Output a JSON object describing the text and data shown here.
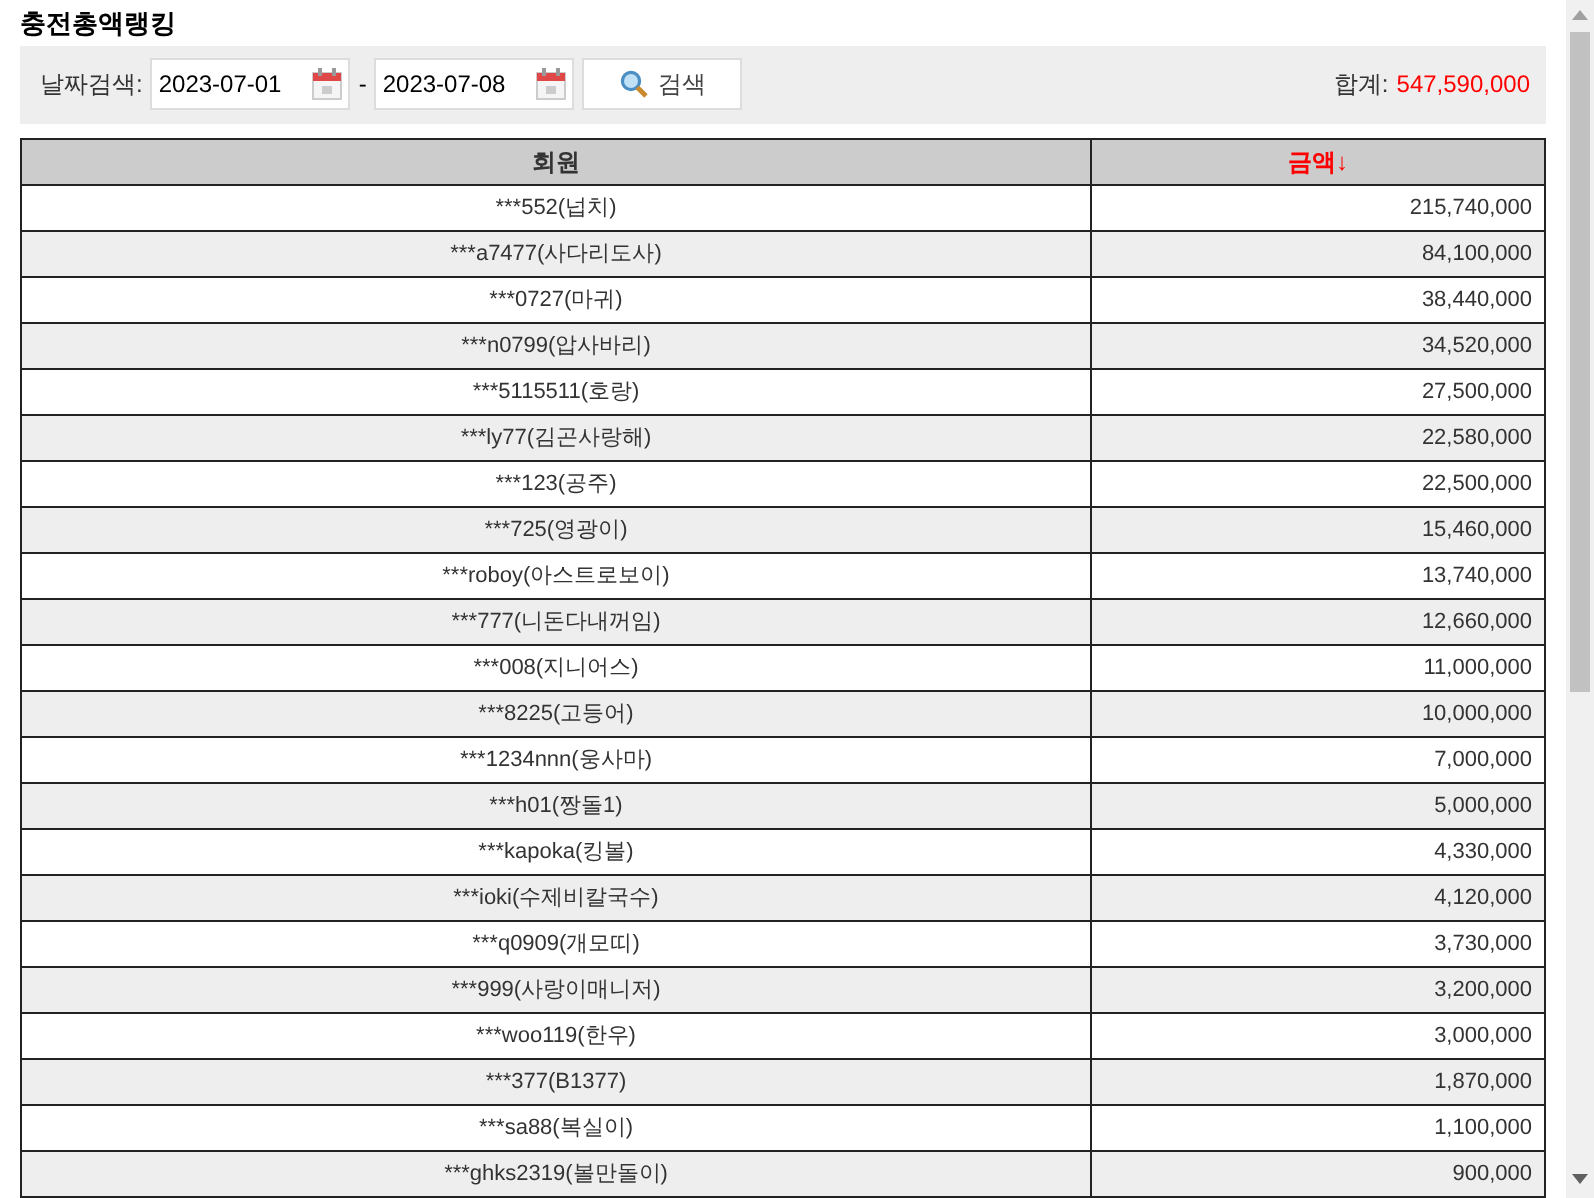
{
  "page_title": "충전총액랭킹",
  "search": {
    "label": "날짜검색:",
    "date_from": "2023-07-01",
    "separator": "-",
    "date_to": "2023-07-08",
    "button": "검색"
  },
  "total": {
    "label": "합계:",
    "value": "547,590,000"
  },
  "table": {
    "columns": [
      {
        "label": "회원",
        "sorted": false
      },
      {
        "label": "금액↓",
        "sorted": true
      }
    ],
    "rows": [
      {
        "member": "***552(넙치)",
        "amount": "215,740,000"
      },
      {
        "member": "***a7477(사다리도사)",
        "amount": "84,100,000"
      },
      {
        "member": "***0727(마귀)",
        "amount": "38,440,000"
      },
      {
        "member": "***n0799(압사바리)",
        "amount": "34,520,000"
      },
      {
        "member": "***5115511(호랑)",
        "amount": "27,500,000"
      },
      {
        "member": "***ly77(김곤사랑해)",
        "amount": "22,580,000"
      },
      {
        "member": "***123(공주)",
        "amount": "22,500,000"
      },
      {
        "member": "***725(영광이)",
        "amount": "15,460,000"
      },
      {
        "member": "***roboy(아스트로보이)",
        "amount": "13,740,000"
      },
      {
        "member": "***777(니돈다내꺼임)",
        "amount": "12,660,000"
      },
      {
        "member": "***008(지니어스)",
        "amount": "11,000,000"
      },
      {
        "member": "***8225(고등어)",
        "amount": "10,000,000"
      },
      {
        "member": "***1234nnn(웅사마)",
        "amount": "7,000,000"
      },
      {
        "member": "***h01(짱돌1)",
        "amount": "5,000,000"
      },
      {
        "member": "***kapoka(킹볼)",
        "amount": "4,330,000"
      },
      {
        "member": "***ioki(수제비칼국수)",
        "amount": "4,120,000"
      },
      {
        "member": "***q0909(개모띠)",
        "amount": "3,730,000"
      },
      {
        "member": "***999(사랑이매니저)",
        "amount": "3,200,000"
      },
      {
        "member": "***woo119(한우)",
        "amount": "3,000,000"
      },
      {
        "member": "***377(B1377)",
        "amount": "1,870,000"
      },
      {
        "member": "***sa88(복실이)",
        "amount": "1,100,000"
      },
      {
        "member": "***ghks2319(볼만돌이)",
        "amount": "900,000"
      }
    ]
  }
}
